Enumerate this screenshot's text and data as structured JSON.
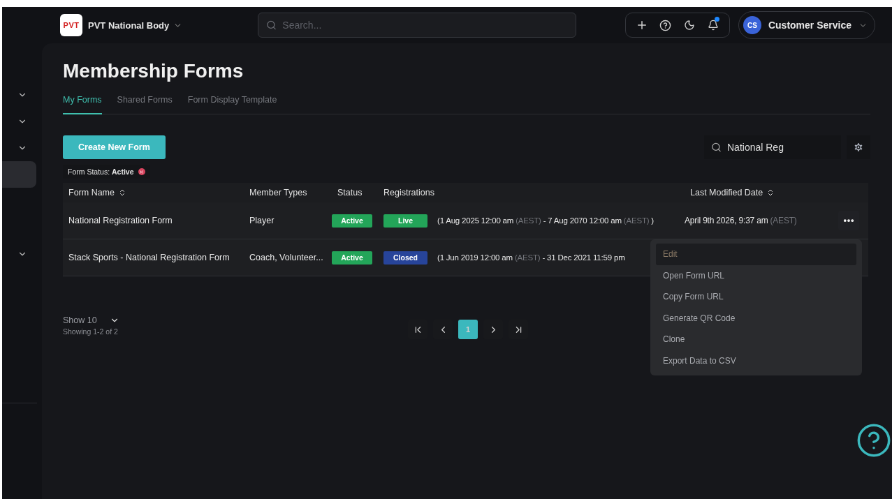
{
  "header": {
    "org_logo": "PVT",
    "org_name": "PVT National Body",
    "search": {
      "placeholder": "Search..."
    },
    "notifications_unread": true,
    "user": {
      "initials": "CS",
      "name": "Customer Service"
    }
  },
  "sidebar": {
    "items": [
      {
        "selected": false
      },
      {
        "selected": false
      },
      {
        "selected": false
      },
      {
        "selected": true
      },
      {
        "selected": false
      }
    ]
  },
  "page": {
    "title": "Membership Forms"
  },
  "tabs": [
    {
      "label": "My Forms",
      "selected": true
    },
    {
      "label": "Shared Forms",
      "selected": false
    },
    {
      "label": "Form Display Template",
      "selected": false
    }
  ],
  "create_button": "Create New Form",
  "table_search": {
    "value": "National Reg"
  },
  "filter_chip": "Form Status: **Active**",
  "table": {
    "columns": [
      {
        "label": "Form Name",
        "sortable": true
      },
      {
        "label": "Member Types",
        "sortable": false
      },
      {
        "label": "Status",
        "sortable": false
      },
      {
        "label": "Registrations",
        "sortable": false
      },
      {
        "label": "Last Modified Date",
        "sortable": true
      }
    ],
    "rows": [
      {
        "name": "National Registration Form",
        "member_types": "Player",
        "status": {
          "label": "Active",
          "kind": "active"
        },
        "registration": {
          "label": "Live",
          "kind": "live"
        },
        "range": [
          {
            "text": "(1 Aug 2025 12:00 am",
            "muted": false
          },
          {
            "text": "(AEST)",
            "muted": true
          },
          {
            "text": "- 7 Aug 2070 12:00 am",
            "muted": false
          },
          {
            "text": "(AEST)",
            "muted": true
          },
          {
            "text": ")",
            "muted": false
          }
        ],
        "modified": [
          {
            "text": "April 9th 2026, 9:37 am",
            "muted": false
          },
          {
            "text": "(AEST)",
            "muted": true
          }
        ],
        "menu_open": true
      },
      {
        "name": "Stack Sports - National Registration Form",
        "member_types": "Coach, Volunteer...",
        "status": {
          "label": "Active",
          "kind": "active"
        },
        "registration": {
          "label": "Closed",
          "kind": "closed"
        },
        "range": [
          {
            "text": "(1 Jun 2019 12:00 am",
            "muted": false
          },
          {
            "text": "(AEST)",
            "muted": true
          },
          {
            "text": "- 31 Dec 2021 11:59 pm",
            "muted": false
          }
        ],
        "modified": [],
        "menu_open": false
      }
    ]
  },
  "row_menu": [
    {
      "label": "Edit",
      "highlighted": true
    },
    {
      "label": "Open Form URL",
      "highlighted": false
    },
    {
      "label": "Copy Form URL",
      "highlighted": false
    },
    {
      "label": "Generate QR Code",
      "highlighted": false
    },
    {
      "label": "Clone",
      "highlighted": false
    },
    {
      "label": "Export Data to CSV",
      "highlighted": false
    }
  ],
  "pagination": {
    "page_size": "Show 10",
    "summary": "Showing 1-2 of 2",
    "pages": [
      {
        "label": "1",
        "selected": true
      }
    ]
  }
}
